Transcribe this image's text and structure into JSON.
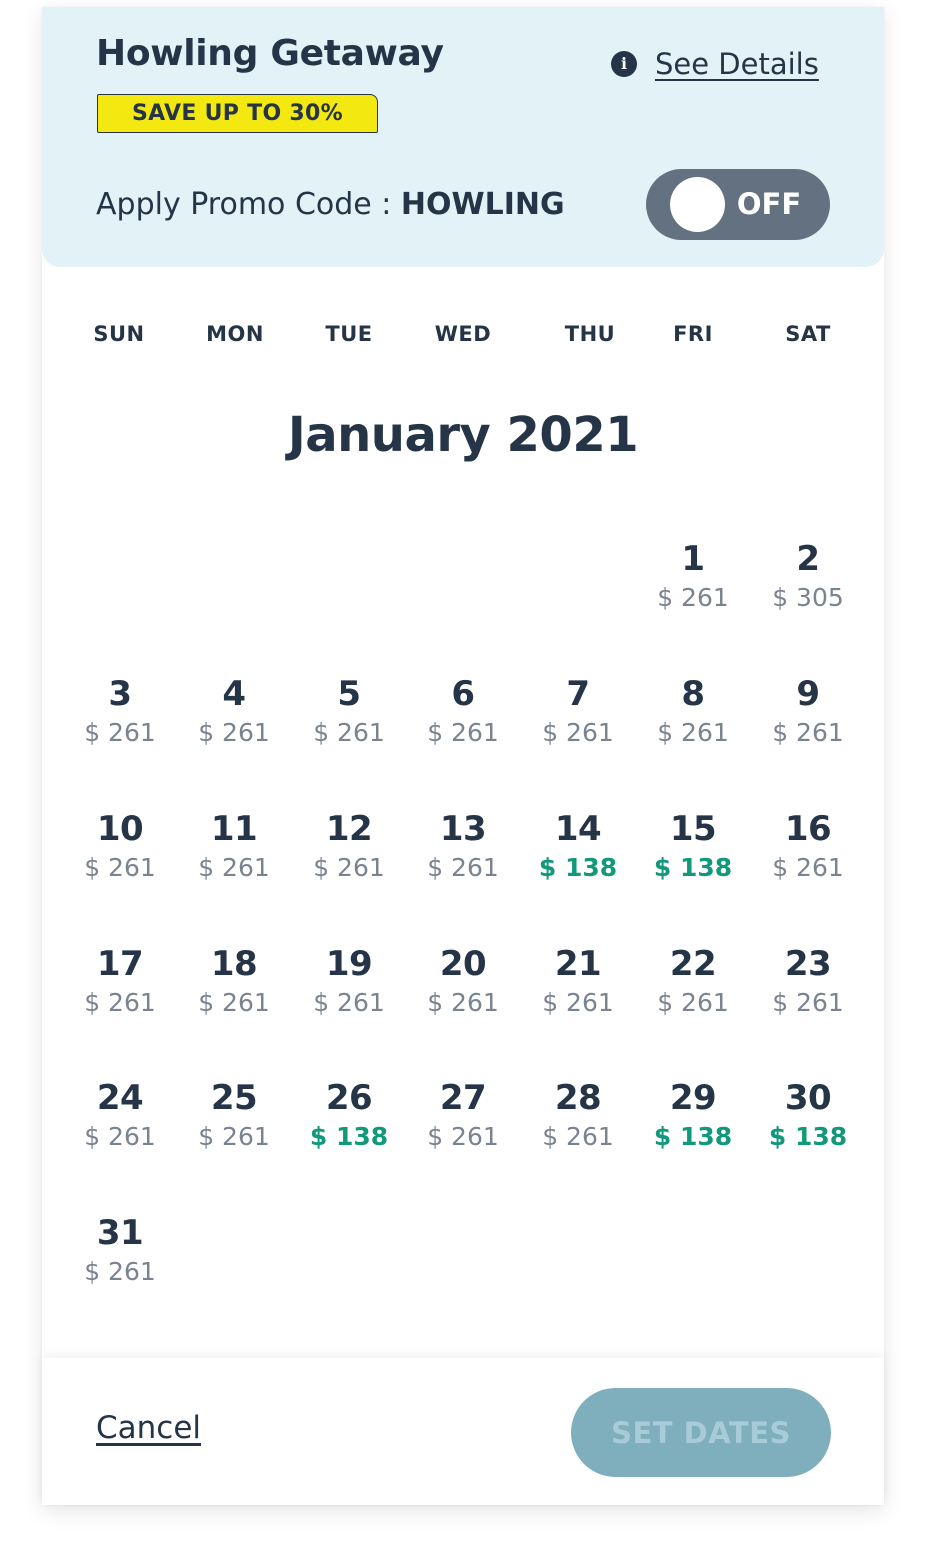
{
  "promo": {
    "title": "Howling Getaway",
    "badge": "SAVE UP TO 30%",
    "details_link": "See Details",
    "info_icon": "i",
    "apply_label": "Apply Promo Code : ",
    "code": "HOWLING",
    "toggle": {
      "state": "OFF",
      "on": false
    }
  },
  "weekdays": [
    "SUN",
    "MON",
    "TUE",
    "WED",
    "THU",
    "FRI",
    "SAT"
  ],
  "calendar": {
    "month_title": "January 2021",
    "first_weekday_index": 5,
    "days": [
      {
        "num": "1",
        "price": "$ 261",
        "deal": false
      },
      {
        "num": "2",
        "price": "$ 305",
        "deal": false
      },
      {
        "num": "3",
        "price": "$ 261",
        "deal": false
      },
      {
        "num": "4",
        "price": "$ 261",
        "deal": false
      },
      {
        "num": "5",
        "price": "$ 261",
        "deal": false
      },
      {
        "num": "6",
        "price": "$ 261",
        "deal": false
      },
      {
        "num": "7",
        "price": "$ 261",
        "deal": false
      },
      {
        "num": "8",
        "price": "$ 261",
        "deal": false
      },
      {
        "num": "9",
        "price": "$ 261",
        "deal": false
      },
      {
        "num": "10",
        "price": "$ 261",
        "deal": false
      },
      {
        "num": "11",
        "price": "$ 261",
        "deal": false
      },
      {
        "num": "12",
        "price": "$ 261",
        "deal": false
      },
      {
        "num": "13",
        "price": "$ 261",
        "deal": false
      },
      {
        "num": "14",
        "price": "$ 138",
        "deal": true
      },
      {
        "num": "15",
        "price": "$ 138",
        "deal": true
      },
      {
        "num": "16",
        "price": "$ 261",
        "deal": false
      },
      {
        "num": "17",
        "price": "$ 261",
        "deal": false
      },
      {
        "num": "18",
        "price": "$ 261",
        "deal": false
      },
      {
        "num": "19",
        "price": "$ 261",
        "deal": false
      },
      {
        "num": "20",
        "price": "$ 261",
        "deal": false
      },
      {
        "num": "21",
        "price": "$ 261",
        "deal": false
      },
      {
        "num": "22",
        "price": "$ 261",
        "deal": false
      },
      {
        "num": "23",
        "price": "$ 261",
        "deal": false
      },
      {
        "num": "24",
        "price": "$ 261",
        "deal": false
      },
      {
        "num": "25",
        "price": "$ 261",
        "deal": false
      },
      {
        "num": "26",
        "price": "$ 138",
        "deal": true
      },
      {
        "num": "27",
        "price": "$ 261",
        "deal": false
      },
      {
        "num": "28",
        "price": "$ 261",
        "deal": false
      },
      {
        "num": "29",
        "price": "$ 138",
        "deal": true
      },
      {
        "num": "30",
        "price": "$ 138",
        "deal": true
      },
      {
        "num": "31",
        "price": "$ 261",
        "deal": false
      }
    ]
  },
  "footer": {
    "cancel_label": "Cancel",
    "set_dates_label": "SET DATES"
  },
  "colors": {
    "promo_bg": "#e2f2f6",
    "text": "#253447",
    "price": "#7a8390",
    "deal_price": "#12987a",
    "badge": "#f3e80f",
    "toggle_off": "#647181",
    "button_disabled": "#7faebd"
  },
  "icons": {
    "info": "info-icon"
  }
}
